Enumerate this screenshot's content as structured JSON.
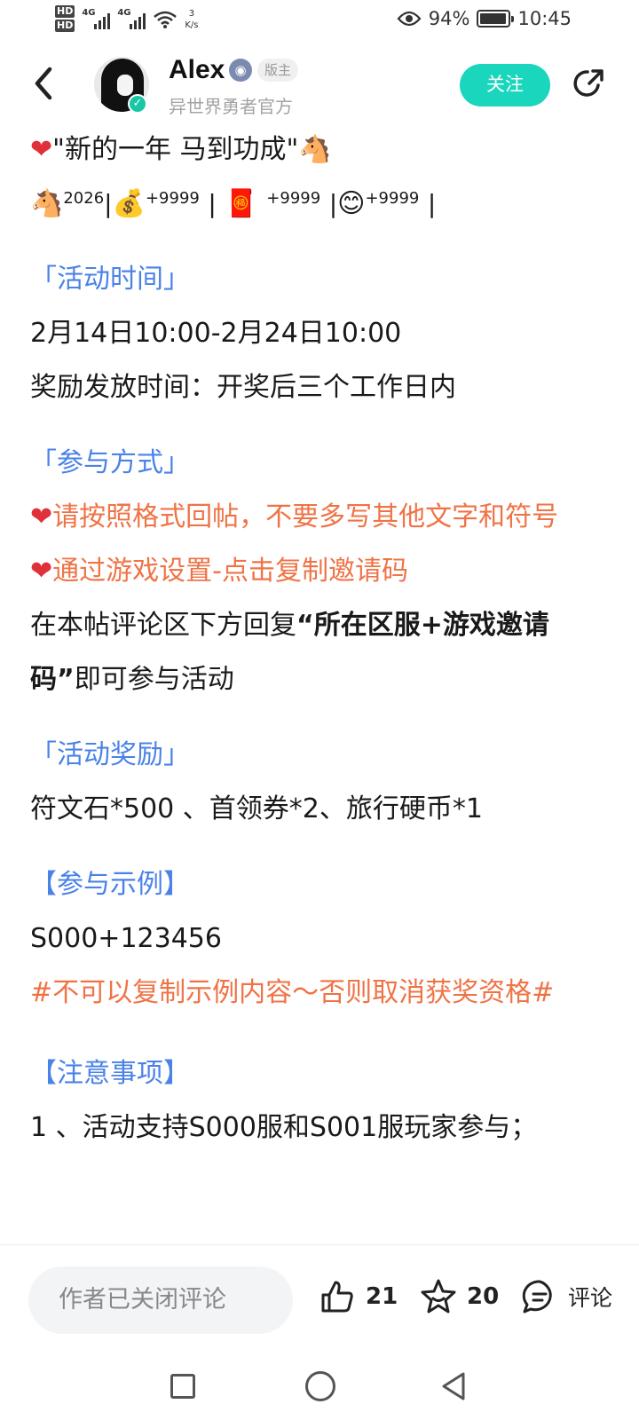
{
  "status": {
    "hd1": "HD",
    "hd2": "HD",
    "net1": "4G",
    "net2": "4G",
    "speed_value": "3",
    "speed_unit": "K/s",
    "battery": "94%",
    "battery_level": 0.94,
    "time": "10:45"
  },
  "header": {
    "username": "Alex",
    "role": "版主",
    "subtitle": "异世界勇者官方",
    "follow_label": "关注"
  },
  "post": {
    "title": "\"新的一年  马到功成\"",
    "stats": {
      "year": "2026",
      "money": "+9999",
      "redpacket": "+9999",
      "smile": "+9999"
    },
    "time_section": "「活动时间」",
    "time_range": "2月14日10:00-2月24日10:00",
    "reward_time": "奖励发放时间：开奖后三个工作日内",
    "method_section": "「参与方式」",
    "method_rule1": "请按照格式回帖，不要多写其他文字和符号",
    "method_rule2": "通过游戏设置-点击复制邀请码",
    "method_desc_pre": "在本帖评论区下方回复",
    "method_desc_bold": "“所在区服+游戏邀请码”",
    "method_desc_post": "即可参与活动",
    "reward_section": "「活动奖励」",
    "reward_items": "符文石*500 、首领券*2、旅行硬币*1",
    "example_section": "【参与示例】",
    "example_code": "S000+123456",
    "example_warning": "#不可以复制示例内容～否则取消获奖资格#",
    "notes_section": "【注意事项】",
    "note1": "1 、活动支持S000服和S001服玩家参与；"
  },
  "bottom": {
    "comment_placeholder": "作者已关闭评论",
    "likes": "21",
    "favorites": "20",
    "comment_label": "评论"
  }
}
